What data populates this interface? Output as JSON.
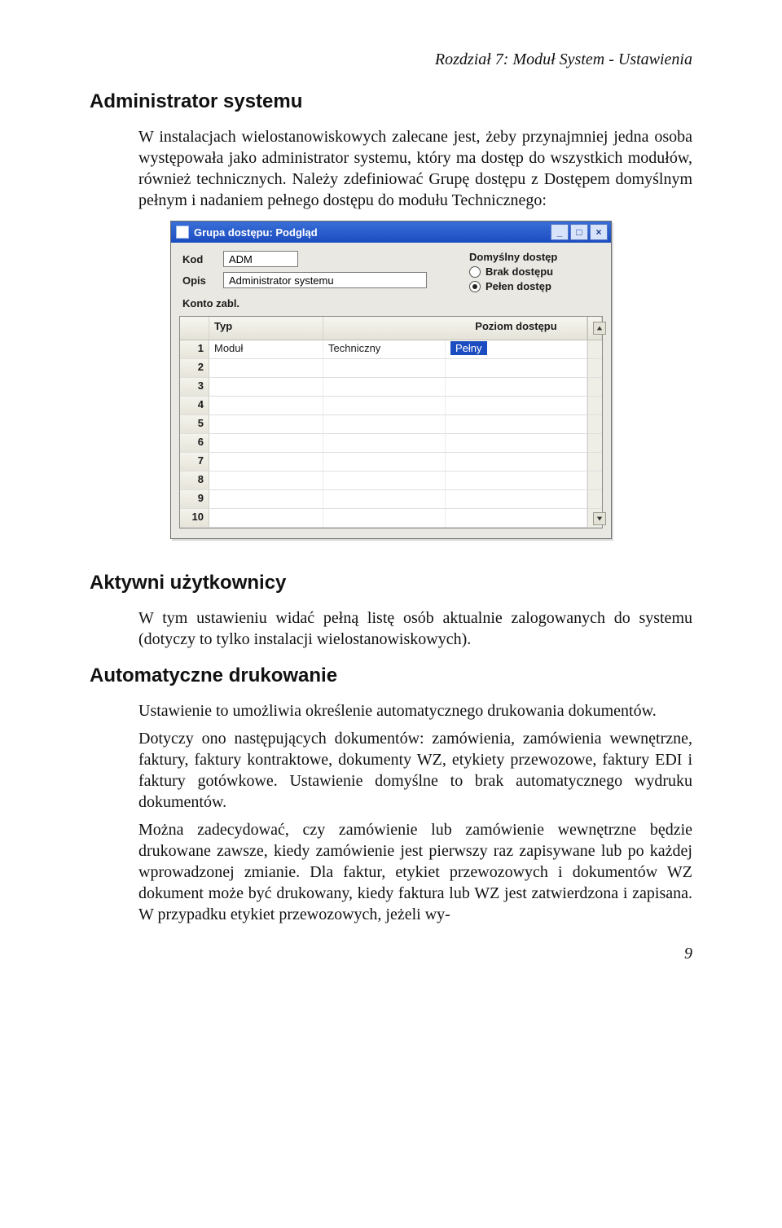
{
  "doc": {
    "chapter_header": "Rozdział 7: Moduł System - Ustawienia",
    "h1_admin": "Administrator systemu",
    "p_admin": "W instalacjach wielostanowiskowych zalecane jest, żeby przynajmniej jedna osoba występowała jako administrator systemu, który ma dostęp do wszystkich modułów, również technicznych. Należy zdefiniować Grupę dostępu z Dostępem domyślnym pełnym i nadaniem pełnego dostępu do modułu Technicznego:",
    "h2_active": "Aktywni użytkownicy",
    "p_active": "W tym ustawieniu widać pełną listę osób aktualnie zalogowanych do systemu (dotyczy to tylko instalacji wielostanowiskowych).",
    "h2_print": "Automatyczne drukowanie",
    "p_print1": "Ustawienie to umożliwia określenie automatycznego drukowania dokumentów.",
    "p_print2": "Dotyczy ono następujących dokumentów: zamówienia, zamówienia wewnętrzne, faktury, faktury kontraktowe, dokumenty WZ, etykiety przewozowe, faktury EDI i faktury gotówkowe. Ustawienie domyślne to brak automatycznego wydruku dokumentów.",
    "p_print3": "Można zadecydować, czy zamówienie lub zamówienie wewnętrzne będzie drukowane zawsze, kiedy zamówienie jest pierwszy raz zapisywane lub po każdej wprowadzonej zmianie. Dla faktur, etykiet przewozowych i dokumentów WZ dokument może być drukowany, kiedy faktura lub WZ jest zatwierdzona i zapisana. W przypadku etykiet przewozowych, jeżeli wy-",
    "page_number": "9"
  },
  "dialog": {
    "title": "Grupa dostępu: Podgląd",
    "winbtn_min": "_",
    "winbtn_max": "□",
    "winbtn_close": "×",
    "kod_label": "Kod",
    "kod_value": "ADM",
    "opis_label": "Opis",
    "opis_value": "Administrator systemu",
    "default_access_title": "Domyślny dostęp",
    "radio_none": "Brak dostępu",
    "radio_full": "Pełen dostęp",
    "konto_label": "Konto zabl.",
    "col_typ": "Typ",
    "col_poziom": "Poziom dostępu",
    "rows": [
      {
        "n": "1",
        "typ": "Moduł",
        "name": "Techniczny",
        "level": "Pełny"
      },
      {
        "n": "2",
        "typ": "",
        "name": "",
        "level": ""
      },
      {
        "n": "3",
        "typ": "",
        "name": "",
        "level": ""
      },
      {
        "n": "4",
        "typ": "",
        "name": "",
        "level": ""
      },
      {
        "n": "5",
        "typ": "",
        "name": "",
        "level": ""
      },
      {
        "n": "6",
        "typ": "",
        "name": "",
        "level": ""
      },
      {
        "n": "7",
        "typ": "",
        "name": "",
        "level": ""
      },
      {
        "n": "8",
        "typ": "",
        "name": "",
        "level": ""
      },
      {
        "n": "9",
        "typ": "",
        "name": "",
        "level": ""
      },
      {
        "n": "10",
        "typ": "",
        "name": "",
        "level": ""
      }
    ]
  }
}
